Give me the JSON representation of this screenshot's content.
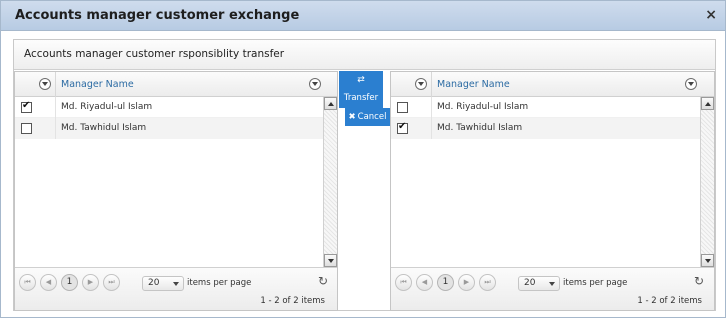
{
  "dialog": {
    "title": "Accounts manager customer exchange",
    "close_glyph": "×"
  },
  "panel": {
    "subtitle": "Accounts manager customer rsponsiblity transfer"
  },
  "actions": {
    "transfer_icon": "⇄",
    "transfer_label": "Transfer",
    "cancel_icon": "✖",
    "cancel_label": "Cancel"
  },
  "left_grid": {
    "column_header": "Manager Name",
    "rows": [
      {
        "name": "Md. Riyadul-ul Islam",
        "checked": true
      },
      {
        "name": "Md. Tawhidul Islam",
        "checked": false
      }
    ],
    "pager": {
      "first": "⏮",
      "prev": "◀",
      "page": "1",
      "next": "▶",
      "last": "⏭",
      "page_size": "20",
      "items_per_page_label": "items per page",
      "refresh_glyph": "↻",
      "info": "1 - 2 of 2 items"
    }
  },
  "right_grid": {
    "column_header": "Manager Name",
    "rows": [
      {
        "name": "Md. Riyadul-ul Islam",
        "checked": false
      },
      {
        "name": "Md. Tawhidul Islam",
        "checked": true
      }
    ],
    "pager": {
      "first": "⏮",
      "prev": "◀",
      "page": "1",
      "next": "▶",
      "last": "⏭",
      "page_size": "20",
      "items_per_page_label": "items per page",
      "refresh_glyph": "↻",
      "info": "1 - 2 of 2 items"
    }
  },
  "colors": {
    "titlebar": "#c3d4ea",
    "accent": "#2b7fd0",
    "header_link": "#2c6ba3"
  }
}
